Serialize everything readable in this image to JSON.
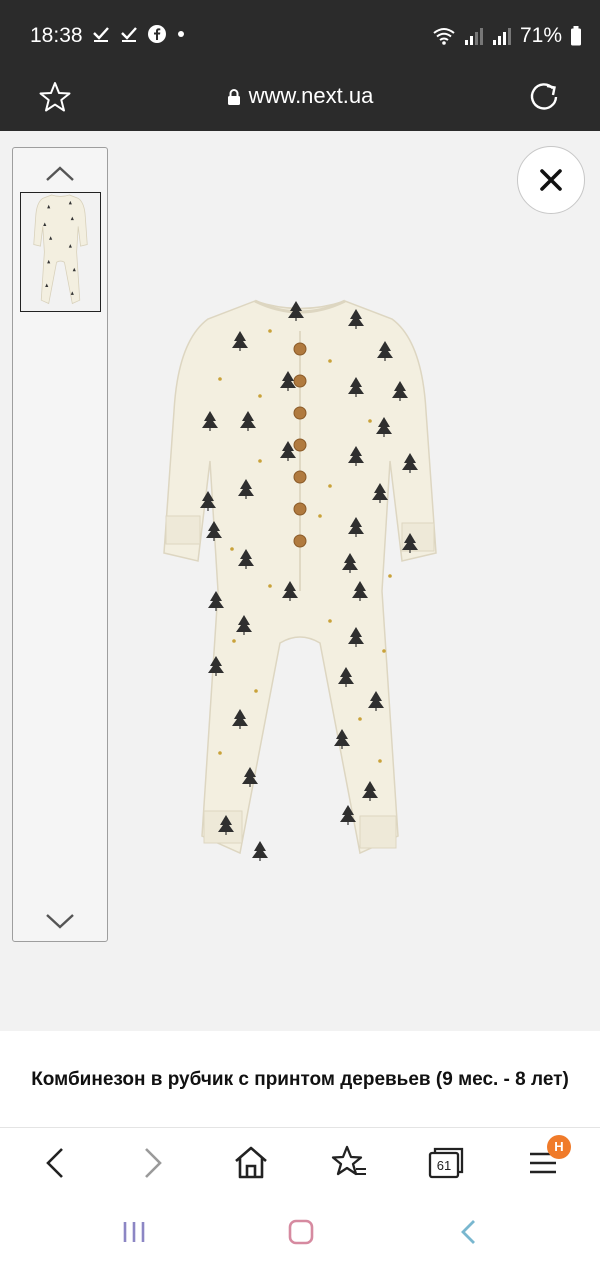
{
  "status_bar": {
    "time": "18:38",
    "battery": "71%"
  },
  "url_bar": {
    "url": "www.next.ua"
  },
  "viewer": {
    "close_icon": "close-icon"
  },
  "product": {
    "title": "Комбинезон в рубчик с принтом деревьев (9 мес. - 8 лет)"
  },
  "toolbar": {
    "tabs_count": "61",
    "menu_badge": "H"
  },
  "colors": {
    "bar": "#2b2b2b",
    "accent_badge": "#f07b2a",
    "garment": "#f3efe0"
  }
}
